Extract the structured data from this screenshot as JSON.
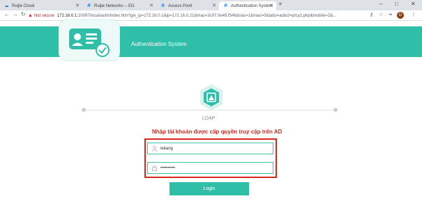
{
  "browser": {
    "tabs": [
      {
        "label": "Ruijie Cloud",
        "icon": "cloud-icon"
      },
      {
        "label": "Ruijie Networks -- EG",
        "icon": "ruijie-icon"
      },
      {
        "label": "Access Point",
        "icon": "ruijie-icon"
      },
      {
        "label": "Authentication System",
        "icon": "ruijie-icon"
      }
    ],
    "not_secure": "Not secure",
    "url_host": "172.16.0.1",
    "url_rest": ":20097/local/auth/index.htm?gw_ip=172.16.0.1&ip=172.16.0.21&mac=3c97.0e49.f546&nas=1&mac=0&tabs=ad&cf=plcy2.php&mobile=2&...",
    "profile_initial": "D",
    "new_tab": "+",
    "window_controls": [
      "–",
      "□",
      "✕"
    ]
  },
  "header": {
    "title": "Authentication System",
    "accent": "#2fbfa9"
  },
  "form": {
    "step_label": "LDAP",
    "hint": "Nhập tài khoản được cấp quyền truy cập trên AD",
    "username": "lebang",
    "password": "••••••••••",
    "login_label": "Login"
  },
  "colors": {
    "highlight": "#d6281d",
    "hint_text": "#d6281d"
  }
}
